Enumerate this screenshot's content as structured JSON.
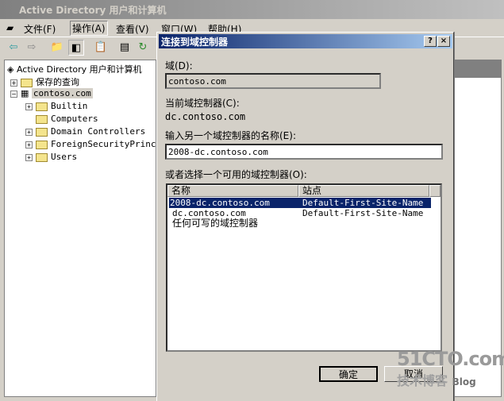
{
  "window": {
    "title": "Active Directory 用户和计算机"
  },
  "menu": [
    "文件(F)",
    "操作(A)",
    "查看(V)",
    "窗口(W)",
    "帮助(H)"
  ],
  "toolbar": [
    "back-icon",
    "forward-icon",
    "up-folder-icon",
    "show-hide-tree-icon",
    "paste-icon",
    "properties-icon",
    "refresh-icon"
  ],
  "tree": {
    "root": "Active Directory 用户和计算机",
    "saved": "保存的查询",
    "domain": "contoso.com",
    "children": [
      "Builtin",
      "Computers",
      "Domain Controllers",
      "ForeignSecurityPrincipals",
      "Users"
    ]
  },
  "dialog": {
    "title": "连接到域控制器",
    "help": "?",
    "close": "×",
    "domain_label": "域(D):",
    "domain_value": "contoso.com",
    "current_label": "当前域控制器(C):",
    "current_value": "dc.contoso.com",
    "enter_label": "输入另一个域控制器的名称(E):",
    "enter_value": "2008-dc.contoso.com",
    "choose_label": "或者选择一个可用的域控制器(O):",
    "columns": [
      "名称",
      "站点"
    ],
    "rows": [
      {
        "name": "2008-dc.contoso.com",
        "site": "Default-First-Site-Name",
        "selected": true
      },
      {
        "name": "dc.contoso.com",
        "site": "Default-First-Site-Name",
        "selected": false
      },
      {
        "name": "任何可写的域控制器",
        "site": "",
        "selected": false
      }
    ],
    "ok": "确定",
    "cancel": "取消"
  },
  "watermark": {
    "line1": "51CTO.com",
    "line2": "技术博客",
    "line3": "Blog"
  },
  "colors": {
    "selection": "#0a246a",
    "title_active": "#0a246a"
  }
}
